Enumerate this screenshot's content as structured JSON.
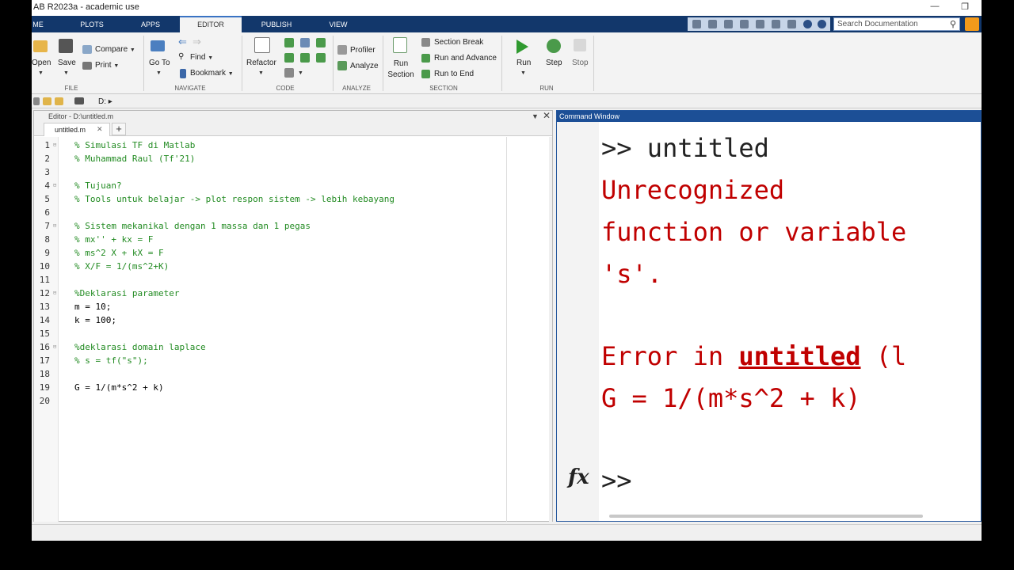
{
  "window": {
    "title": "AB R2023a - academic use"
  },
  "tabs": [
    "ME",
    "PLOTS",
    "APPS",
    "EDITOR",
    "PUBLISH",
    "VIEW"
  ],
  "search": {
    "placeholder": "Search Documentation"
  },
  "ribbon": {
    "file": {
      "open": "Open",
      "save": "Save",
      "compare": "Compare",
      "print": "Print",
      "group": "FILE"
    },
    "navigate": {
      "goto": "Go To",
      "find": "Find",
      "bookmark": "Bookmark",
      "group": "NAVIGATE"
    },
    "code": {
      "refactor": "Refactor",
      "group": "CODE"
    },
    "analyze": {
      "profiler": "Profiler",
      "analyze": "Analyze",
      "group": "ANALYZE"
    },
    "section": {
      "run_section": "Run Section",
      "section_break": "Section Break",
      "run_advance": "Run and Advance",
      "run_end": "Run to End",
      "group": "SECTION"
    },
    "run": {
      "run": "Run",
      "step": "Step",
      "stop": "Stop",
      "group": "RUN"
    }
  },
  "address": {
    "path": "D: ▸"
  },
  "editor": {
    "title": "Editor - D:\\untitled.m",
    "file_tab": "untitled.m",
    "lines": [
      {
        "n": "1",
        "text": "% Simulasi TF di Matlab",
        "type": "cm"
      },
      {
        "n": "2",
        "text": "% Muhammad Raul (Tf'21)",
        "type": "cm"
      },
      {
        "n": "3",
        "text": "",
        "type": "plain"
      },
      {
        "n": "4",
        "text": "% Tujuan?",
        "type": "cm"
      },
      {
        "n": "5",
        "text": "% Tools untuk belajar -> plot respon sistem -> lebih kebayang",
        "type": "cm"
      },
      {
        "n": "6",
        "text": "",
        "type": "plain"
      },
      {
        "n": "7",
        "text": "% Sistem mekanikal dengan 1 massa dan 1 pegas",
        "type": "cm"
      },
      {
        "n": "8",
        "text": "% mx'' + kx = F",
        "type": "cm"
      },
      {
        "n": "9",
        "text": "% ms^2 X + kX = F",
        "type": "cm"
      },
      {
        "n": "10",
        "text": "% X/F = 1/(ms^2+K)",
        "type": "cm"
      },
      {
        "n": "11",
        "text": "",
        "type": "plain"
      },
      {
        "n": "12",
        "text": "%Deklarasi parameter",
        "type": "cm"
      },
      {
        "n": "13",
        "text": "m = 10;",
        "type": "plain"
      },
      {
        "n": "14",
        "text": "k = 100;",
        "type": "plain"
      },
      {
        "n": "15",
        "text": "",
        "type": "plain"
      },
      {
        "n": "16",
        "text": "%deklarasi domain laplace",
        "type": "cm"
      },
      {
        "n": "17",
        "text": "% s = tf(\"s\");",
        "type": "cm"
      },
      {
        "n": "18",
        "text": "",
        "type": "plain"
      },
      {
        "n": "19",
        "text": "G = 1/(m*s^2 + k)",
        "type": "plain"
      },
      {
        "n": "20",
        "text": "",
        "type": "plain"
      }
    ]
  },
  "command_window": {
    "title": "Command Window",
    "prompt_cmd": ">> untitled",
    "err1": "Unrecognized",
    "err2": "function or variable",
    "err3": "'s'.",
    "err_in_prefix": "Error in ",
    "err_in_link": "untitled",
    "err_in_suffix": " (l",
    "err_line": "G = 1/(m*s^2 + k)",
    "prompt": ">>"
  },
  "colors": {
    "tabbar": "#12376b",
    "comment": "#228b22",
    "error": "#c00000",
    "cmd_title": "#1c4f96"
  }
}
